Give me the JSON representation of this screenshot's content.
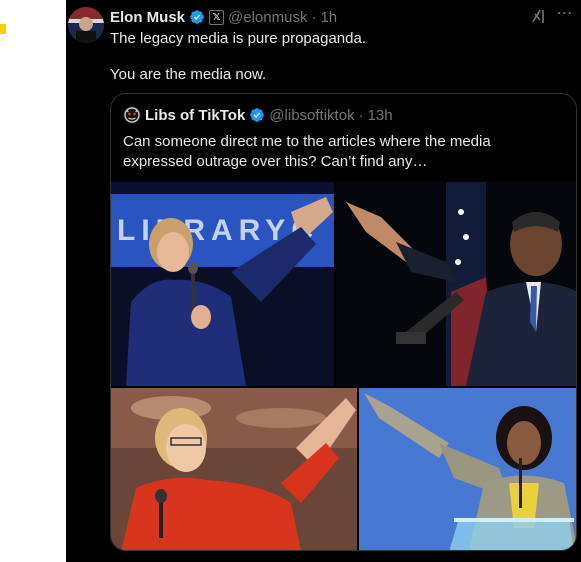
{
  "tweet": {
    "author_name": "Elon Musk",
    "handle": "@elonmusk",
    "separator": "·",
    "time": "1h",
    "line1": "The legacy media is pure propaganda.",
    "line2": "You are the media now."
  },
  "quote": {
    "author_name": "Libs of TikTok",
    "handle": "@libsoftiktok",
    "separator": "·",
    "time": "13h",
    "text": "Can someone direct me to the articles where the media expressed outrage over this? Can’t find any…"
  },
  "photos": {
    "photo1_sign": "LIBRARYC"
  },
  "colors": {
    "background": "#000000",
    "text": "#e7e9ea",
    "muted": "#71767b",
    "verified": "#1d9bf0",
    "border": "#2f3336"
  },
  "icons": [
    "verified-badge-icon",
    "x-affiliate-badge-icon",
    "grok-icon",
    "more-options-icon"
  ]
}
